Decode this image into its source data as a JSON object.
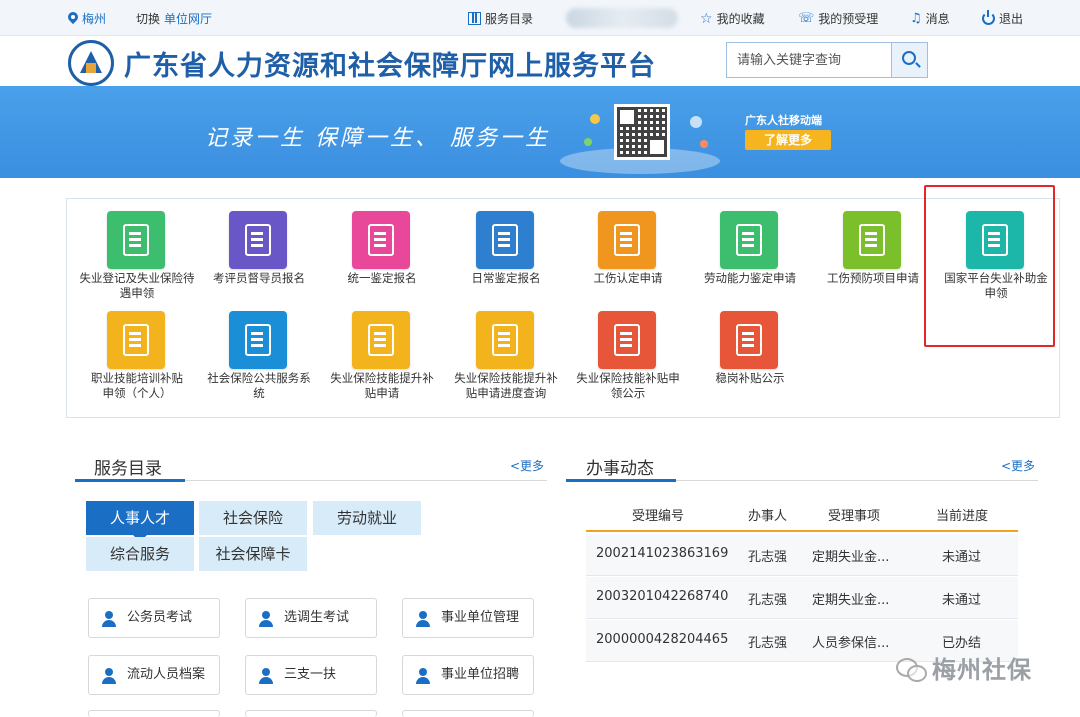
{
  "topbar": {
    "city": "梅州",
    "switch_label": "切换",
    "hall": "单位网厅",
    "service_directory": "服务目录",
    "favorites": "我的收藏",
    "my_applications": "我的预受理",
    "messages": "消息",
    "logout": "退出"
  },
  "header": {
    "title": "广东省人力资源和社会保障厅网上服务平台",
    "search_placeholder": "请输入关键字查询"
  },
  "banner": {
    "slogan": "记录一生  保障一生、 服务一生",
    "mobile_title": "广东人社移动端",
    "learn_more": "了解更多"
  },
  "services": [
    {
      "label": "失业登记及失业保险待遇申领",
      "color": "#3dbd6e",
      "icon": "id-card-icon"
    },
    {
      "label": "考评员督导员报名",
      "color": "#6a57c7",
      "icon": "document-person-icon"
    },
    {
      "label": "统一鉴定报名",
      "color": "#e8479a",
      "icon": "bed-form-icon"
    },
    {
      "label": "日常鉴定报名",
      "color": "#2f7fd1",
      "icon": "id-badge-icon"
    },
    {
      "label": "工伤认定申请",
      "color": "#f0961e",
      "icon": "medical-form-icon"
    },
    {
      "label": "劳动能力鉴定申请",
      "color": "#3dbd6e",
      "icon": "people-exchange-icon"
    },
    {
      "label": "工伤预防项目申请",
      "color": "#7bbf2a",
      "icon": "form-plus-icon"
    },
    {
      "label": "国家平台失业补助金申领",
      "color": "#1cb7a8",
      "icon": "yuan-document-icon"
    },
    {
      "label": "职业技能培训补贴申领（个人）",
      "color": "#f2b31d",
      "icon": "pill-jar-icon"
    },
    {
      "label": "社会保险公共服务系统",
      "color": "#1a8fd8",
      "icon": "user-search-icon"
    },
    {
      "label": "失业保险技能提升补贴申请",
      "color": "#f2b31d",
      "icon": "checklist-icon"
    },
    {
      "label": "失业保险技能提升补贴申请进度查询",
      "color": "#f2b31d",
      "icon": "pill-jar-icon"
    },
    {
      "label": "失业保险技能补贴申领公示",
      "color": "#e8563a",
      "icon": "id-card-icon"
    },
    {
      "label": "稳岗补贴公示",
      "color": "#e8563a",
      "icon": "stacked-documents-icon"
    }
  ],
  "service_panel": {
    "title": "服务目录",
    "more": "<更多",
    "tabs": [
      "人事人才",
      "社会保险",
      "劳动就业",
      "综合服务",
      "社会保障卡"
    ],
    "items": [
      "公务员考试",
      "选调生考试",
      "事业单位管理",
      "流动人员档案",
      "三支一扶",
      "事业单位招聘"
    ]
  },
  "activity_panel": {
    "title": "办事动态",
    "more": "<更多",
    "headers": [
      "受理编号",
      "办事人",
      "受理事项",
      "当前进度"
    ],
    "rows": [
      [
        "2002141023863169",
        "孔志强",
        "定期失业金...",
        "未通过"
      ],
      [
        "2003201042268740",
        "孔志强",
        "定期失业金...",
        "未通过"
      ],
      [
        "2000000428204465",
        "孔志强",
        "人员参保信...",
        "已办结"
      ]
    ]
  },
  "watermark": "梅州社保"
}
